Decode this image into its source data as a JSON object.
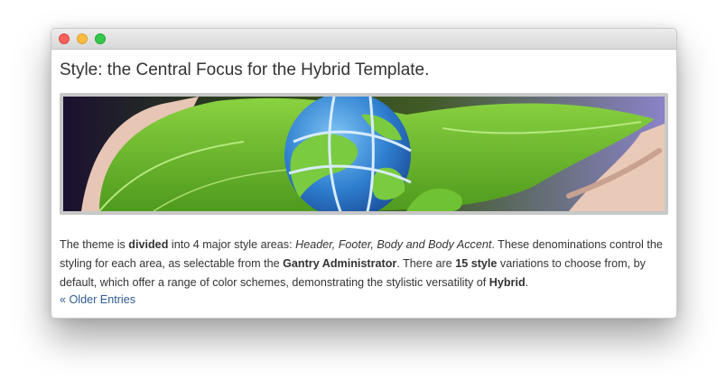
{
  "article": {
    "title": "Style: the Central Focus for the Hybrid Template.",
    "body": {
      "p1": "The theme is ",
      "b1": "divided",
      "p2": " into 4 major style areas: ",
      "i1": "Header, Footer, Body and Body Accent",
      "p3": ". These denominations control the styling for each area, as selectable from the ",
      "b2": "Gantry Administrator",
      "p4": ". There are ",
      "b3": "15 style",
      "p5": " variations to choose from, by default, which offer a range of color schemes, demonstrating the stylistic versatility of ",
      "b4": "Hybrid",
      "p6": "."
    }
  },
  "pagination": {
    "older_label": "« Older Entries"
  },
  "colors": {
    "link": "#2e5a8e",
    "text": "#333333",
    "leaf": "#6fbf2e",
    "globe_ocean": "#3a8ad6"
  }
}
